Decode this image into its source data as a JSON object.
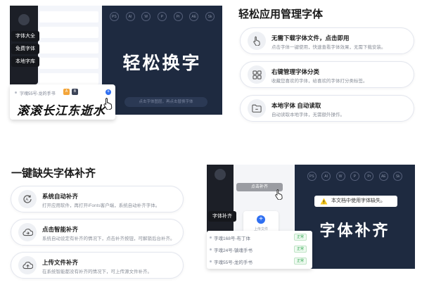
{
  "top_mockup": {
    "pills": [
      "字体大全",
      "免费字体",
      "本地字库"
    ],
    "app_icons": [
      "PS",
      "AI",
      "W",
      "P",
      "Pr",
      "AE",
      "Sk"
    ],
    "title": "轻松换字",
    "search_placeholder": "点击字体图层，再点击替换字体",
    "card_font_name": "字魂55号-龙的手书",
    "card_badge_a": "A",
    "card_badge_b": "B",
    "card_plus": "+",
    "sample_text": "滚滚长江东逝水"
  },
  "section1": {
    "title": "轻松应用管理字体",
    "features": [
      {
        "title": "无需下载字体文件，点击即用",
        "desc": "点击字体一键使用，快速查看字体效果，无需下载安装。",
        "icon": "pointer-hand-icon"
      },
      {
        "title": "右键管理字体分类",
        "desc": "收藏您喜欢的字体，给喜欢的字体打分类标签。",
        "icon": "grid-icon"
      },
      {
        "title": "本地字体 自动读取",
        "desc": "自动读取本地字体，无需额外操作。",
        "icon": "folder-icon"
      }
    ]
  },
  "section2": {
    "title": "一键缺失字体补齐",
    "features": [
      {
        "title": "系统自动补齐",
        "desc": "打开应用软件，再打开iFonts客户端，系统自动补齐字体。",
        "icon": "auto-refresh-icon"
      },
      {
        "title": "点击智能补齐",
        "desc": "系统自动设定有补齐的情况下，点击补齐按钮，可解锁后台补齐。",
        "icon": "cloud-sync-icon"
      },
      {
        "title": "上传文件补齐",
        "desc": "在系统智能都没有补齐的情况下，可上传源文件补齐。",
        "icon": "cloud-upload-icon"
      }
    ]
  },
  "bottom_mockup": {
    "button_label": "点击补齐",
    "pill": "字体补齐",
    "upload_label": "上传文件",
    "upload_plus": "+",
    "notice": "本文档中使用字体缺失。",
    "title": "字体补齐",
    "app_icons": [
      "PS",
      "AI",
      "W",
      "P",
      "Pr",
      "AE",
      "Sk"
    ],
    "fonts": [
      {
        "name": "字魂168号-布丁体",
        "status": "正常"
      },
      {
        "name": "字魂24号-镇魂手书",
        "status": "正常"
      },
      {
        "name": "字魂55号-龙的手书",
        "status": "正常"
      }
    ]
  },
  "colors": {
    "dark_panel": "#1e2a40",
    "sidebar": "#1c1f27",
    "accent_blue": "#2f6ff1",
    "status_green": "#34a853",
    "warning_yellow": "#f5c518"
  }
}
